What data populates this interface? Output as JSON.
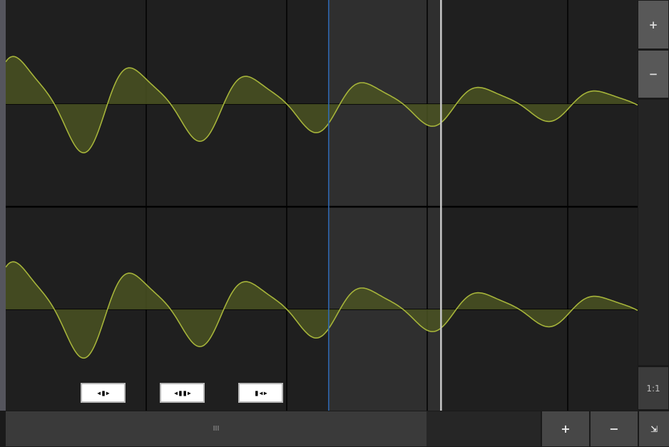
{
  "colors": {
    "background": "#1f1f1f",
    "grid": "#000000",
    "selection": "#2f2f2f",
    "waveform_line": "#a6b43a",
    "waveform_fill": "#4a5222",
    "cursor_blue": "#2f6bb8",
    "playhead_white": "#c8c8c8",
    "button_gray": "#585858"
  },
  "waveform": {
    "channel_count": 2,
    "view_samples": 900,
    "cursor_sample": 460,
    "selection_start_sample": 460,
    "selection_end_sample": 620,
    "playhead_sample": 620,
    "grid_divisions": 4.5
  },
  "selection_buttons": [
    {
      "name": "select-left-button",
      "label": "◂▮▸"
    },
    {
      "name": "select-both-button",
      "label": "◂▮▮▸"
    },
    {
      "name": "select-right-button",
      "label": "▮◂▸"
    }
  ],
  "vertical_zoom": {
    "zoom_in": "+",
    "zoom_out": "−",
    "ratio": "1:1"
  },
  "horizontal_bar": {
    "thumb_grip": "III",
    "zoom_in": "+",
    "zoom_out": "−",
    "corner": "⇲"
  }
}
